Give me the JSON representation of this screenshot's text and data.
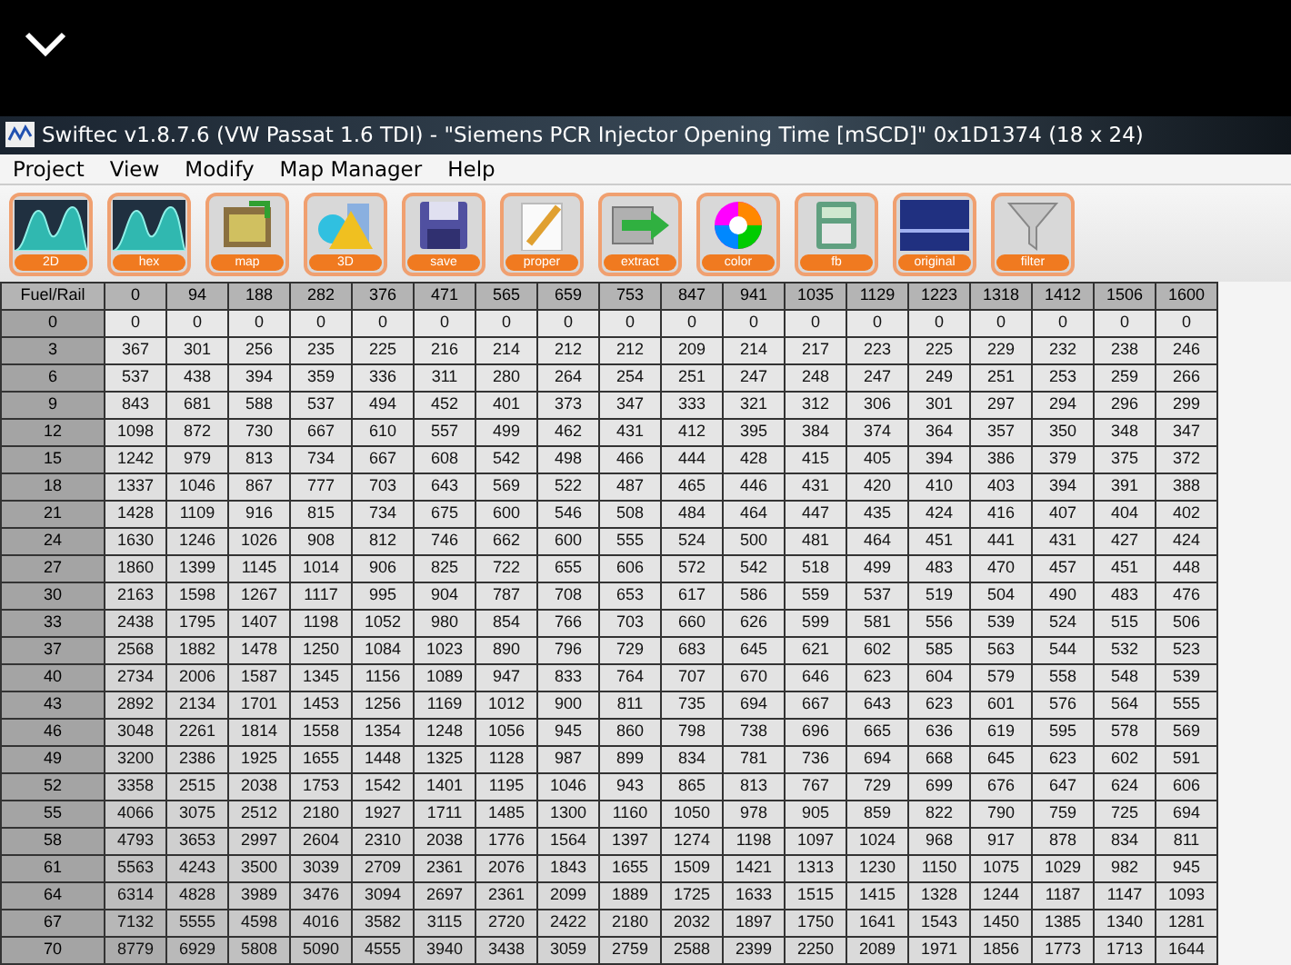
{
  "window": {
    "title": "Swiftec v1.8.7.6 (VW Passat 1.6 TDI) - \"Siemens PCR Injector Opening Time [mSCD]\" 0x1D1374 (18 x 24)"
  },
  "menu": [
    "Project",
    "View",
    "Modify",
    "Map Manager",
    "Help"
  ],
  "toolbar": [
    {
      "label": "2D",
      "kind": "wave"
    },
    {
      "label": "hex",
      "kind": "wave"
    },
    {
      "label": "map",
      "kind": "map"
    },
    {
      "label": "3D",
      "kind": "shapes"
    },
    {
      "label": "save",
      "kind": "floppy"
    },
    {
      "label": "proper",
      "kind": "pencil"
    },
    {
      "label": "extract",
      "kind": "arrow"
    },
    {
      "label": "color",
      "kind": "wheel"
    },
    {
      "label": "fb",
      "kind": "calculator"
    },
    {
      "label": "original",
      "kind": "screen"
    },
    {
      "label": "filter",
      "kind": "funnel"
    }
  ],
  "table": {
    "corner": "Fuel/Rail",
    "columns": [
      "0",
      "94",
      "188",
      "282",
      "376",
      "471",
      "565",
      "659",
      "753",
      "847",
      "941",
      "1035",
      "1129",
      "1223",
      "1318",
      "1412",
      "1506",
      "1600"
    ],
    "rows": [
      {
        "label": "0",
        "cells": [
          "0",
          "0",
          "0",
          "0",
          "0",
          "0",
          "0",
          "0",
          "0",
          "0",
          "0",
          "0",
          "0",
          "0",
          "0",
          "0",
          "0",
          "0"
        ]
      },
      {
        "label": "3",
        "cells": [
          "367",
          "301",
          "256",
          "235",
          "225",
          "216",
          "214",
          "212",
          "212",
          "209",
          "214",
          "217",
          "223",
          "225",
          "229",
          "232",
          "238",
          "246"
        ]
      },
      {
        "label": "6",
        "cells": [
          "537",
          "438",
          "394",
          "359",
          "336",
          "311",
          "280",
          "264",
          "254",
          "251",
          "247",
          "248",
          "247",
          "249",
          "251",
          "253",
          "259",
          "266"
        ]
      },
      {
        "label": "9",
        "cells": [
          "843",
          "681",
          "588",
          "537",
          "494",
          "452",
          "401",
          "373",
          "347",
          "333",
          "321",
          "312",
          "306",
          "301",
          "297",
          "294",
          "296",
          "299"
        ]
      },
      {
        "label": "12",
        "cells": [
          "1098",
          "872",
          "730",
          "667",
          "610",
          "557",
          "499",
          "462",
          "431",
          "412",
          "395",
          "384",
          "374",
          "364",
          "357",
          "350",
          "348",
          "347"
        ]
      },
      {
        "label": "15",
        "cells": [
          "1242",
          "979",
          "813",
          "734",
          "667",
          "608",
          "542",
          "498",
          "466",
          "444",
          "428",
          "415",
          "405",
          "394",
          "386",
          "379",
          "375",
          "372"
        ]
      },
      {
        "label": "18",
        "cells": [
          "1337",
          "1046",
          "867",
          "777",
          "703",
          "643",
          "569",
          "522",
          "487",
          "465",
          "446",
          "431",
          "420",
          "410",
          "403",
          "394",
          "391",
          "388"
        ]
      },
      {
        "label": "21",
        "cells": [
          "1428",
          "1109",
          "916",
          "815",
          "734",
          "675",
          "600",
          "546",
          "508",
          "484",
          "464",
          "447",
          "435",
          "424",
          "416",
          "407",
          "404",
          "402"
        ]
      },
      {
        "label": "24",
        "cells": [
          "1630",
          "1246",
          "1026",
          "908",
          "812",
          "746",
          "662",
          "600",
          "555",
          "524",
          "500",
          "481",
          "464",
          "451",
          "441",
          "431",
          "427",
          "424"
        ]
      },
      {
        "label": "27",
        "cells": [
          "1860",
          "1399",
          "1145",
          "1014",
          "906",
          "825",
          "722",
          "655",
          "606",
          "572",
          "542",
          "518",
          "499",
          "483",
          "470",
          "457",
          "451",
          "448"
        ]
      },
      {
        "label": "30",
        "cells": [
          "2163",
          "1598",
          "1267",
          "1117",
          "995",
          "904",
          "787",
          "708",
          "653",
          "617",
          "586",
          "559",
          "537",
          "519",
          "504",
          "490",
          "483",
          "476"
        ]
      },
      {
        "label": "33",
        "cells": [
          "2438",
          "1795",
          "1407",
          "1198",
          "1052",
          "980",
          "854",
          "766",
          "703",
          "660",
          "626",
          "599",
          "581",
          "556",
          "539",
          "524",
          "515",
          "506"
        ]
      },
      {
        "label": "37",
        "cells": [
          "2568",
          "1882",
          "1478",
          "1250",
          "1084",
          "1023",
          "890",
          "796",
          "729",
          "683",
          "645",
          "621",
          "602",
          "585",
          "563",
          "544",
          "532",
          "523"
        ]
      },
      {
        "label": "40",
        "cells": [
          "2734",
          "2006",
          "1587",
          "1345",
          "1156",
          "1089",
          "947",
          "833",
          "764",
          "707",
          "670",
          "646",
          "623",
          "604",
          "579",
          "558",
          "548",
          "539"
        ]
      },
      {
        "label": "43",
        "cells": [
          "2892",
          "2134",
          "1701",
          "1453",
          "1256",
          "1169",
          "1012",
          "900",
          "811",
          "735",
          "694",
          "667",
          "643",
          "623",
          "601",
          "576",
          "564",
          "555"
        ]
      },
      {
        "label": "46",
        "cells": [
          "3048",
          "2261",
          "1814",
          "1558",
          "1354",
          "1248",
          "1056",
          "945",
          "860",
          "798",
          "738",
          "696",
          "665",
          "636",
          "619",
          "595",
          "578",
          "569"
        ]
      },
      {
        "label": "49",
        "cells": [
          "3200",
          "2386",
          "1925",
          "1655",
          "1448",
          "1325",
          "1128",
          "987",
          "899",
          "834",
          "781",
          "736",
          "694",
          "668",
          "645",
          "623",
          "602",
          "591"
        ]
      },
      {
        "label": "52",
        "cells": [
          "3358",
          "2515",
          "2038",
          "1753",
          "1542",
          "1401",
          "1195",
          "1046",
          "943",
          "865",
          "813",
          "767",
          "729",
          "699",
          "676",
          "647",
          "624",
          "606"
        ]
      },
      {
        "label": "55",
        "cells": [
          "4066",
          "3075",
          "2512",
          "2180",
          "1927",
          "1711",
          "1485",
          "1300",
          "1160",
          "1050",
          "978",
          "905",
          "859",
          "822",
          "790",
          "759",
          "725",
          "694"
        ]
      },
      {
        "label": "58",
        "cells": [
          "4793",
          "3653",
          "2997",
          "2604",
          "2310",
          "2038",
          "1776",
          "1564",
          "1397",
          "1274",
          "1198",
          "1097",
          "1024",
          "968",
          "917",
          "878",
          "834",
          "811"
        ]
      },
      {
        "label": "61",
        "cells": [
          "5563",
          "4243",
          "3500",
          "3039",
          "2709",
          "2361",
          "2076",
          "1843",
          "1655",
          "1509",
          "1421",
          "1313",
          "1230",
          "1150",
          "1075",
          "1029",
          "982",
          "945"
        ]
      },
      {
        "label": "64",
        "cells": [
          "6314",
          "4828",
          "3989",
          "3476",
          "3094",
          "2697",
          "2361",
          "2099",
          "1889",
          "1725",
          "1633",
          "1515",
          "1415",
          "1328",
          "1244",
          "1187",
          "1147",
          "1093"
        ]
      },
      {
        "label": "67",
        "cells": [
          "7132",
          "5555",
          "4598",
          "4016",
          "3582",
          "3115",
          "2720",
          "2422",
          "2180",
          "2032",
          "1897",
          "1750",
          "1641",
          "1543",
          "1450",
          "1385",
          "1340",
          "1281"
        ]
      },
      {
        "label": "70",
        "cells": [
          "8779",
          "6929",
          "5808",
          "5090",
          "4555",
          "3940",
          "3438",
          "3059",
          "2759",
          "2588",
          "2399",
          "2250",
          "2089",
          "1971",
          "1856",
          "1773",
          "1713",
          "1644"
        ]
      }
    ]
  }
}
